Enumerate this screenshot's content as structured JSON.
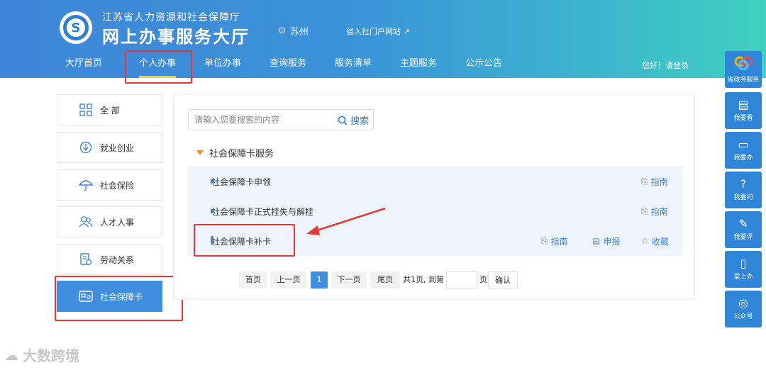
{
  "header": {
    "org_name": "江苏省人力资源和社会保障厅",
    "site_title": "网上办事服务大厅",
    "city": "苏州",
    "portal_link": "省人社门户网站",
    "login_text": "您好！请登录"
  },
  "nav": {
    "items": [
      {
        "label": "大厅首页"
      },
      {
        "label": "个人办事"
      },
      {
        "label": "单位办事"
      },
      {
        "label": "查询服务"
      },
      {
        "label": "服务清单"
      },
      {
        "label": "主题服务"
      },
      {
        "label": "公示公告"
      }
    ],
    "active": "个人办事"
  },
  "sidebar": {
    "items": [
      {
        "label": "全 部",
        "icon": "grid-icon"
      },
      {
        "label": "就业创业",
        "icon": "employment-icon"
      },
      {
        "label": "社会保险",
        "icon": "umbrella-icon"
      },
      {
        "label": "人才人事",
        "icon": "people-icon"
      },
      {
        "label": "劳动关系",
        "icon": "document-icon"
      },
      {
        "label": "社会保障卡",
        "icon": "card-icon"
      }
    ],
    "active": "社会保障卡"
  },
  "search": {
    "placeholder": "请输入您要搜索的内容",
    "button_label": "搜索"
  },
  "group": {
    "title": "社会保障卡服务"
  },
  "services": [
    {
      "label": "社会保障卡申领",
      "guide": "指南"
    },
    {
      "label": "社会保障卡正式挂失与解挂",
      "guide": "指南"
    },
    {
      "label": "社会保障卡补卡",
      "guide": "指南",
      "apply": "申报",
      "favorite": "收藏"
    }
  ],
  "pager": {
    "first": "首页",
    "prev": "上一页",
    "current": "1",
    "next": "下一页",
    "last": "尾页",
    "total_text": "共1页, 到第",
    "page_unit": "页",
    "confirm": "确认"
  },
  "right_bar": {
    "items": [
      {
        "label": "省政务服务"
      },
      {
        "label": "我要看"
      },
      {
        "label": "我要办"
      },
      {
        "label": "我要问"
      },
      {
        "label": "我要评"
      },
      {
        "label": "掌上办"
      },
      {
        "label": "公众号"
      }
    ]
  },
  "watermark": "大数跨境",
  "colors": {
    "primary": "#3f86d8",
    "active_tab_underline": "#ffcc33",
    "annotation_red": "#e53935",
    "group_arrow": "#f08a2e"
  }
}
